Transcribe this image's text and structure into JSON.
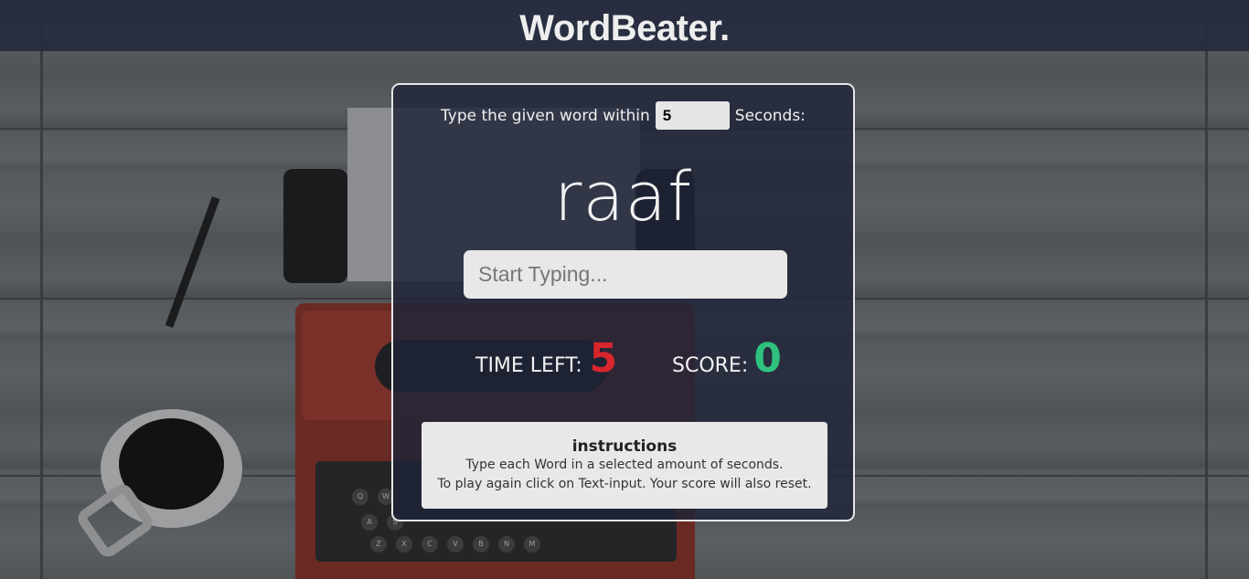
{
  "header": {
    "brand": "WordBeater."
  },
  "game": {
    "intro_before": "Type the given word within",
    "seconds_value": "5",
    "intro_after": "Seconds:",
    "current_word": "raaf",
    "input_placeholder": "Start Typing...",
    "time_left_label": "TIME LEFT:",
    "time_left_value": "5",
    "score_label": "SCORE:",
    "score_value": "0"
  },
  "instructions": {
    "title": "instructions",
    "lines": [
      "Type each Word in a selected amount of seconds.",
      "To play again click on Text-input. Your score will also reset."
    ]
  },
  "background": {
    "keys": [
      "Q",
      "W",
      "A",
      "S",
      "Z",
      "X",
      "C",
      "V",
      "B",
      "N",
      "M"
    ]
  },
  "colors": {
    "header_bg": "#262c3e",
    "time_value": "#d9262c",
    "score_value": "#2ec27e",
    "card_border": "#e6e6e6"
  }
}
